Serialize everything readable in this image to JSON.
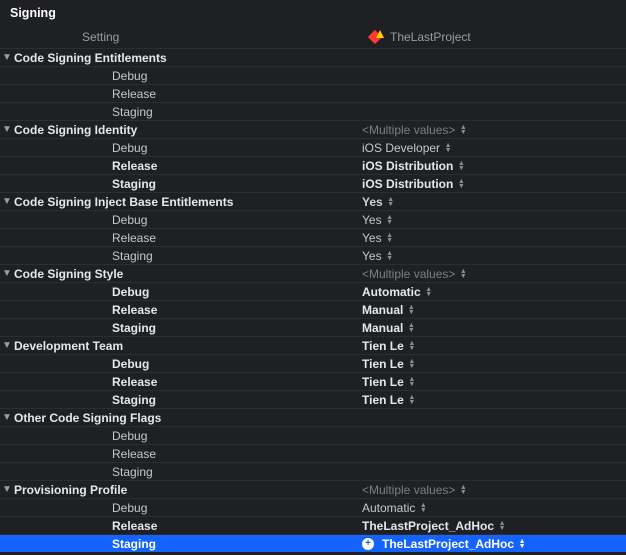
{
  "section": {
    "title": "Signing"
  },
  "columns": {
    "setting": "Setting",
    "target": "TheLastProject"
  },
  "placeholders": {
    "multiple": "<Multiple values>"
  },
  "groups": [
    {
      "name": "Code Signing Entitlements",
      "value": "",
      "stepper": false,
      "dim": false,
      "configs": [
        {
          "label": "Debug",
          "value": "",
          "bold": false,
          "stepper": false
        },
        {
          "label": "Release",
          "value": "",
          "bold": false,
          "stepper": false
        },
        {
          "label": "Staging",
          "value": "",
          "bold": false,
          "stepper": false
        }
      ]
    },
    {
      "name": "Code Signing Identity",
      "value": "<Multiple values>",
      "stepper": true,
      "dim": true,
      "configs": [
        {
          "label": "Debug",
          "value": "iOS Developer",
          "bold": false,
          "stepper": true
        },
        {
          "label": "Release",
          "value": "iOS Distribution",
          "bold": true,
          "stepper": true
        },
        {
          "label": "Staging",
          "value": "iOS Distribution",
          "bold": true,
          "stepper": true
        }
      ]
    },
    {
      "name": "Code Signing Inject Base Entitlements",
      "value": "Yes",
      "stepper": true,
      "dim": false,
      "configs": [
        {
          "label": "Debug",
          "value": "Yes",
          "bold": false,
          "stepper": true
        },
        {
          "label": "Release",
          "value": "Yes",
          "bold": false,
          "stepper": true
        },
        {
          "label": "Staging",
          "value": "Yes",
          "bold": false,
          "stepper": true
        }
      ]
    },
    {
      "name": "Code Signing Style",
      "value": "<Multiple values>",
      "stepper": true,
      "dim": true,
      "configs": [
        {
          "label": "Debug",
          "value": "Automatic",
          "bold": true,
          "stepper": true
        },
        {
          "label": "Release",
          "value": "Manual",
          "bold": true,
          "stepper": true
        },
        {
          "label": "Staging",
          "value": "Manual",
          "bold": true,
          "stepper": true
        }
      ]
    },
    {
      "name": "Development Team",
      "value": "Tien Le",
      "stepper": true,
      "dim": false,
      "bold": true,
      "configs": [
        {
          "label": "Debug",
          "value": "Tien Le",
          "bold": true,
          "stepper": true
        },
        {
          "label": "Release",
          "value": "Tien Le",
          "bold": true,
          "stepper": true
        },
        {
          "label": "Staging",
          "value": "Tien Le",
          "bold": true,
          "stepper": true
        }
      ]
    },
    {
      "name": "Other Code Signing Flags",
      "value": "",
      "stepper": false,
      "dim": false,
      "configs": [
        {
          "label": "Debug",
          "value": "",
          "bold": false,
          "stepper": false
        },
        {
          "label": "Release",
          "value": "",
          "bold": false,
          "stepper": false
        },
        {
          "label": "Staging",
          "value": "",
          "bold": false,
          "stepper": false
        }
      ]
    },
    {
      "name": "Provisioning Profile",
      "value": "<Multiple values>",
      "stepper": true,
      "dim": true,
      "configs": [
        {
          "label": "Debug",
          "value": "Automatic",
          "bold": false,
          "stepper": true
        },
        {
          "label": "Release",
          "value": "TheLastProject_AdHoc",
          "bold": true,
          "stepper": true
        },
        {
          "label": "Staging",
          "value": "TheLastProject_AdHoc",
          "bold": true,
          "stepper": true,
          "selected": true,
          "plus": true
        }
      ]
    }
  ]
}
